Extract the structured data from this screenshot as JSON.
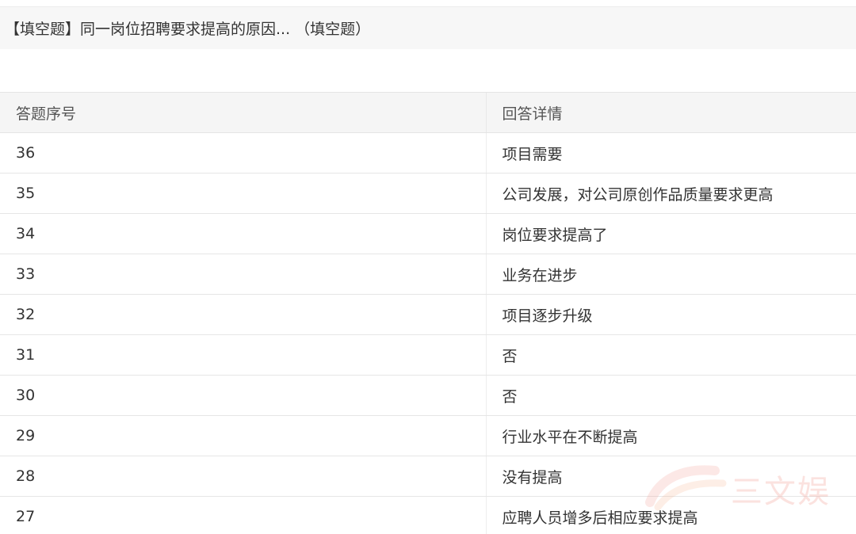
{
  "question": {
    "title": "【填空题】同一岗位招聘要求提高的原因... （填空题）"
  },
  "table": {
    "headers": {
      "index": "答题序号",
      "answer": "回答详情"
    },
    "rows": [
      {
        "index": "36",
        "answer": "项目需要"
      },
      {
        "index": "35",
        "answer": "公司发展，对公司原创作品质量要求更高"
      },
      {
        "index": "34",
        "answer": "岗位要求提高了"
      },
      {
        "index": "33",
        "answer": "业务在进步"
      },
      {
        "index": "32",
        "answer": "项目逐步升级"
      },
      {
        "index": "31",
        "answer": "否"
      },
      {
        "index": "30",
        "answer": "否"
      },
      {
        "index": "29",
        "answer": "行业水平在不断提高"
      },
      {
        "index": "28",
        "answer": "没有提高"
      },
      {
        "index": "27",
        "answer": "应聘人员增多后相应要求提高"
      }
    ]
  },
  "watermark": {
    "text": "三文娱",
    "icon": "brushstroke-logo-icon",
    "color": "#f0968c"
  }
}
